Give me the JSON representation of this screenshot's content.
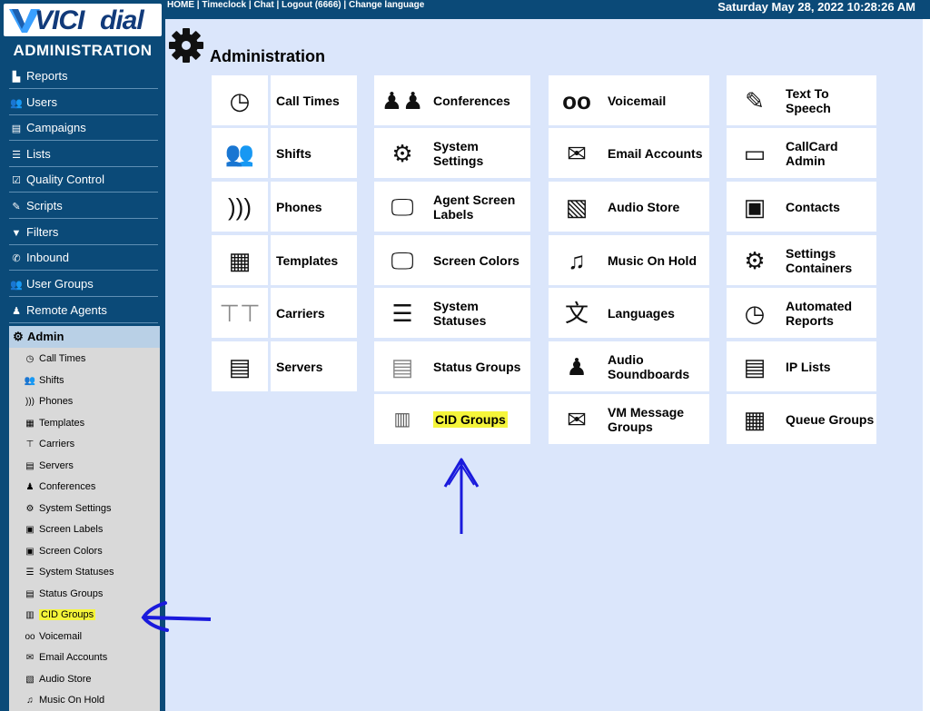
{
  "logo": {
    "part1": "VICI",
    "part2": "dial"
  },
  "sidebar": {
    "heading": "ADMINISTRATION",
    "items": [
      {
        "label": "Reports",
        "icon": "chart-icon"
      },
      {
        "label": "Users",
        "icon": "users-icon"
      },
      {
        "label": "Campaigns",
        "icon": "campaigns-icon"
      },
      {
        "label": "Lists",
        "icon": "lists-icon"
      },
      {
        "label": "Quality Control",
        "icon": "checkbox-icon"
      },
      {
        "label": "Scripts",
        "icon": "pencil-icon"
      },
      {
        "label": "Filters",
        "icon": "filter-icon"
      },
      {
        "label": "Inbound",
        "icon": "inbound-icon"
      },
      {
        "label": "User Groups",
        "icon": "user-groups-icon"
      },
      {
        "label": "Remote Agents",
        "icon": "remote-agents-icon"
      }
    ],
    "admin": {
      "label": "Admin",
      "sub_items": [
        "Call Times",
        "Shifts",
        "Phones",
        "Templates",
        "Carriers",
        "Servers",
        "Conferences",
        "System Settings",
        "Screen Labels",
        "Screen Colors",
        "System Statuses",
        "Status Groups",
        "CID Groups",
        "Voicemail",
        "Email Accounts",
        "Audio Store",
        "Music On Hold"
      ]
    }
  },
  "topbar": {
    "links": [
      "HOME",
      "Timeclock",
      "Chat",
      "Logout (6666)",
      "Change language"
    ],
    "separator": " | ",
    "datetime": "Saturday May 28, 2022 10:28:26 AM"
  },
  "page": {
    "title": "Administration"
  },
  "tiles": {
    "col1": [
      "Call Times",
      "Shifts",
      "Phones",
      "Templates",
      "Carriers",
      "Servers"
    ],
    "col2": [
      "Conferences",
      "System Settings",
      "Agent Screen Labels",
      "Screen Colors",
      "System Statuses",
      "Status Groups",
      "CID Groups"
    ],
    "col3": [
      "Voicemail",
      "Email Accounts",
      "Audio Store",
      "Music On Hold",
      "Languages",
      "Audio Soundboards",
      "VM Message Groups"
    ],
    "col4": [
      "Text To Speech",
      "CallCard Admin",
      "Contacts",
      "Settings Containers",
      "Automated Reports",
      "IP Lists",
      "Queue Groups"
    ]
  },
  "colors": {
    "sidebar": "#0b4a78",
    "content": "#dbe6fb",
    "highlight": "#f5f53a",
    "annotation": "#1a1adc"
  }
}
